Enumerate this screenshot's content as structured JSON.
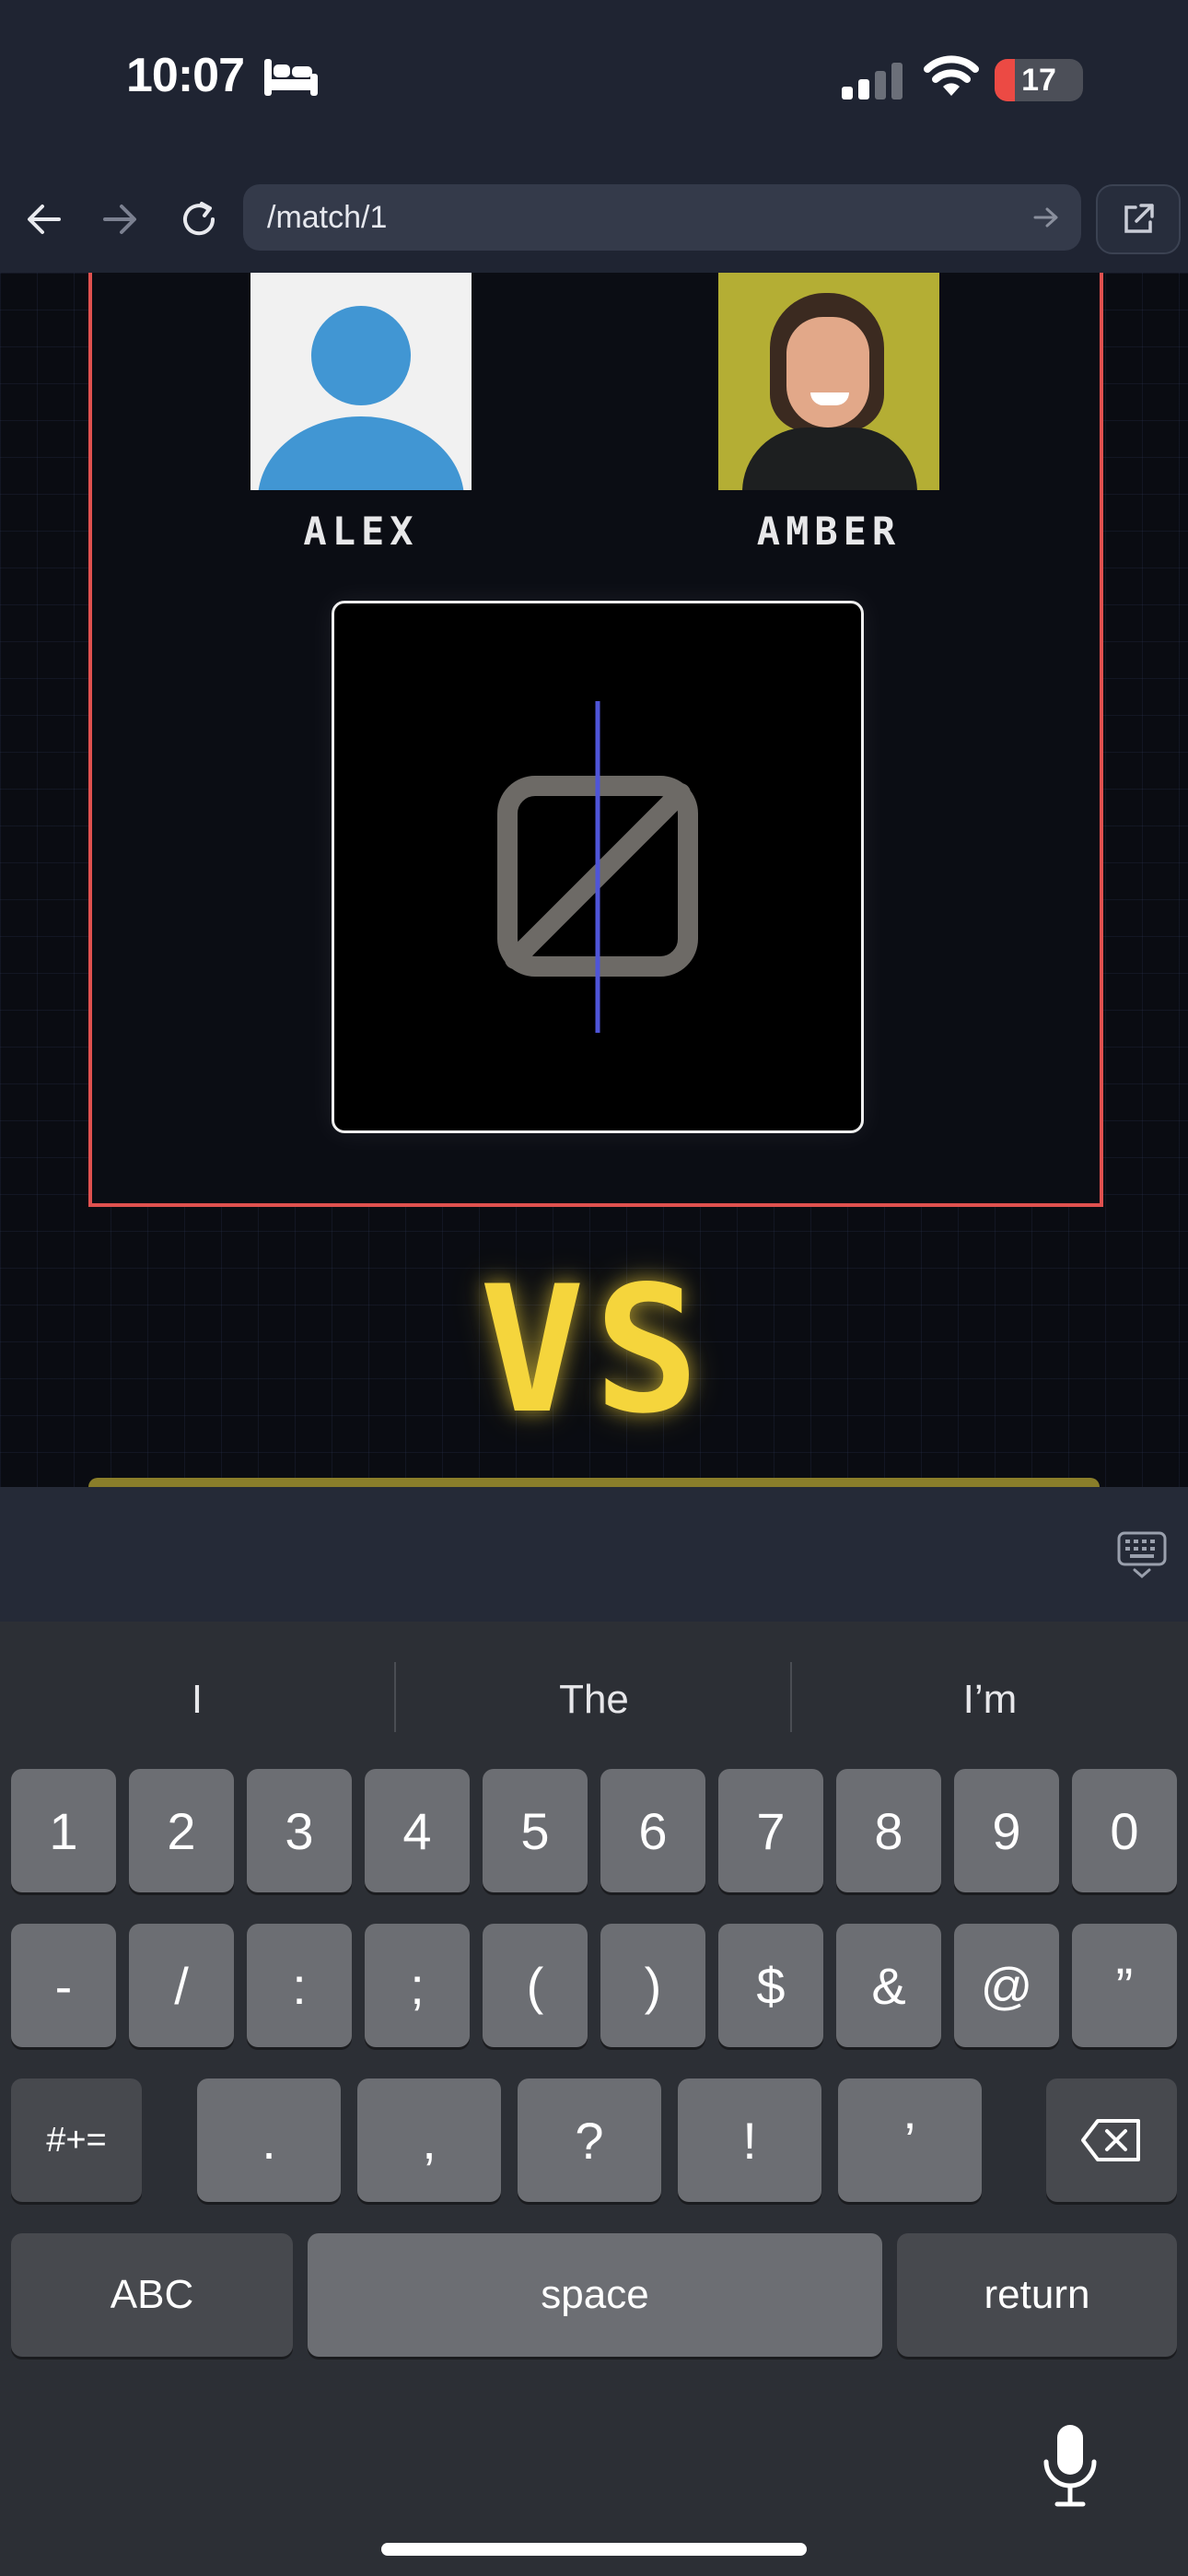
{
  "status_bar": {
    "time": "10:07",
    "battery": "17",
    "icons": [
      "sleep-focus-icon",
      "cellular-signal-icon",
      "wifi-icon",
      "battery-icon"
    ]
  },
  "browser": {
    "url": "/match/1",
    "icons": [
      "back-arrow-icon",
      "forward-arrow-icon",
      "reload-icon",
      "url-go-icon",
      "open-external-icon"
    ]
  },
  "match": {
    "player_left": {
      "name": "ALEX",
      "avatar": "default-avatar"
    },
    "player_right": {
      "name": "AMBER",
      "avatar": "photo"
    },
    "video_state": "video-off-icon",
    "vs_label": "VS",
    "colors": {
      "card_border": "#e0514f",
      "vs": "#f5d53c",
      "video_line": "#4f55d8"
    }
  },
  "keyboard": {
    "suggestions": [
      "I",
      "The",
      "I’m"
    ],
    "row1": [
      "1",
      "2",
      "3",
      "4",
      "5",
      "6",
      "7",
      "8",
      "9",
      "0"
    ],
    "row2": [
      "-",
      "/",
      ":",
      ";",
      "(",
      ")",
      "$",
      "&",
      "@",
      "”"
    ],
    "row3": [
      ".",
      ",",
      "?",
      "!",
      "’"
    ],
    "symbols_toggle": "#+=",
    "abc": "ABC",
    "space": "space",
    "return": "return"
  }
}
